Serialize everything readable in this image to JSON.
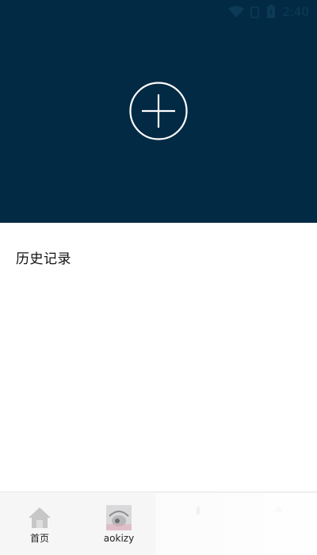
{
  "status_bar": {
    "time": "2:40",
    "icons": [
      "wifi-icon",
      "signal-icon",
      "battery-icon"
    ]
  },
  "hero": {
    "background_color": "#022a44",
    "action_icon": "plus-circle-icon"
  },
  "history": {
    "title": "历史记录"
  },
  "bottom_nav": {
    "items": [
      {
        "label": "首页",
        "icon": "home-icon"
      },
      {
        "label": "aokizy",
        "icon": "avatar-icon"
      },
      {
        "label": "",
        "icon": "nav-icon-3"
      },
      {
        "label": "",
        "icon": "nav-icon-4"
      }
    ]
  }
}
